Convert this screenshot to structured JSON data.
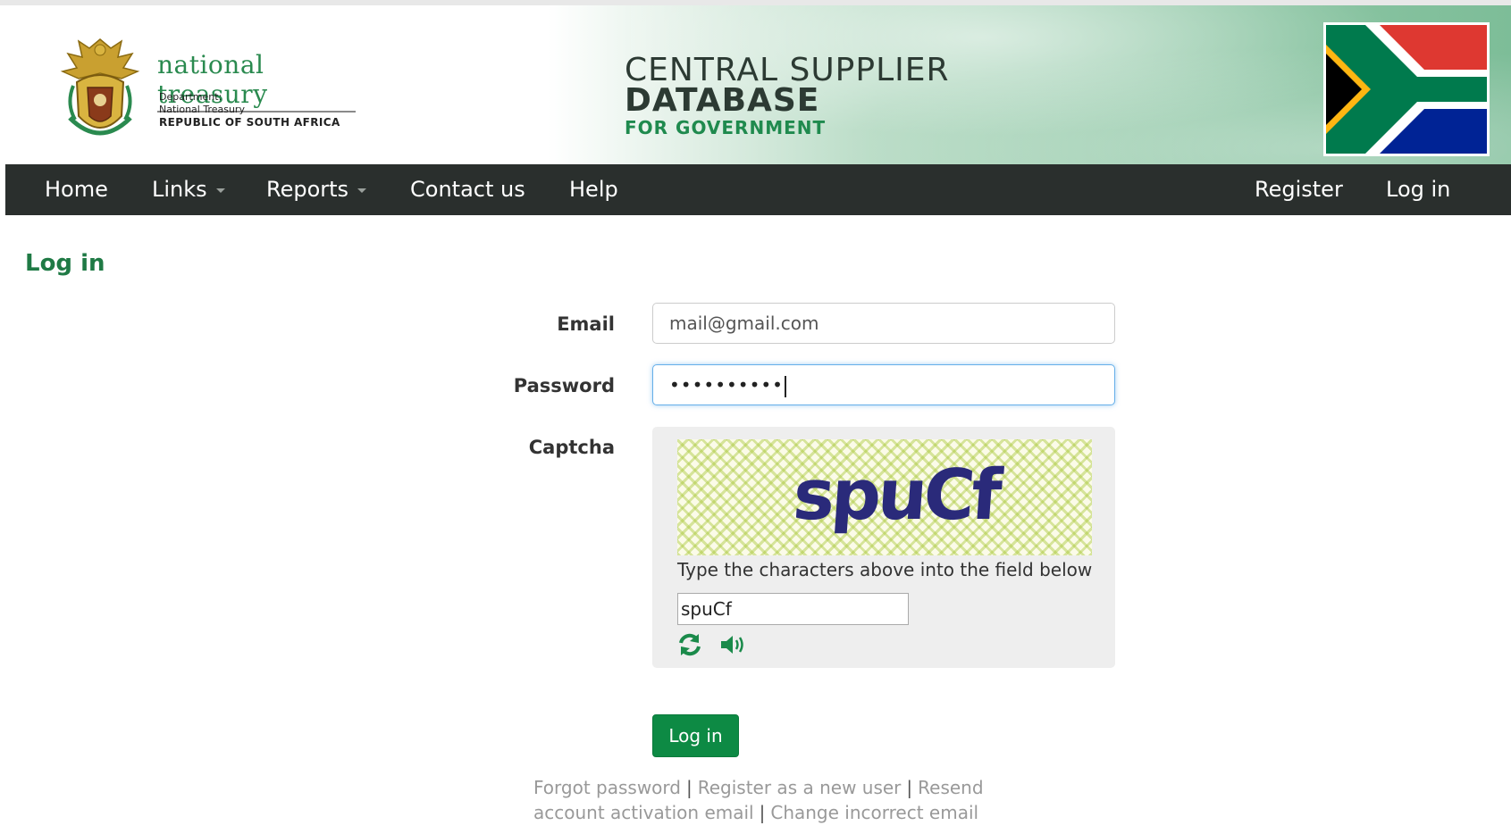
{
  "header": {
    "logo": {
      "title": "national treasury",
      "line1": "Department:",
      "line2": "National Treasury",
      "line3": "REPUBLIC OF SOUTH AFRICA"
    },
    "banner": {
      "line1": "CENTRAL SUPPLIER",
      "line2": "DATABASE",
      "line3": "FOR GOVERNMENT"
    }
  },
  "nav": {
    "left": [
      "Home",
      "Links",
      "Reports",
      "Contact us",
      "Help"
    ],
    "right": [
      "Register",
      "Log in"
    ]
  },
  "page": {
    "title": "Log in"
  },
  "form": {
    "email_label": "Email",
    "email_value": "mail@gmail.com",
    "password_label": "Password",
    "password_value": "••••••••••",
    "captcha_label": "Captcha",
    "captcha_image_text": "spuCf",
    "captcha_instruction": "Type the characters above into the field below",
    "captcha_value": "spuCf",
    "submit_label": "Log in"
  },
  "links": {
    "forgot": "Forgot password",
    "register": "Register as a new user",
    "resend": "Resend account activation email",
    "change_email": "Change incorrect email"
  },
  "colors": {
    "brand_green": "#1f7a45",
    "button_green": "#0d8a44",
    "navbar": "#2a2f2d"
  },
  "icons": {
    "refresh": "refresh-icon",
    "audio": "audio-icon"
  }
}
